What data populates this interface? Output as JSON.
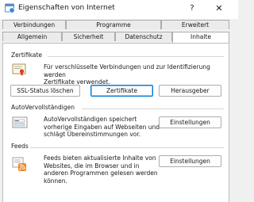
{
  "window": {
    "title": "Eigenschaften von Internet",
    "help_glyph": "?",
    "close_glyph": "✕"
  },
  "tabs": {
    "row1": [
      {
        "label": "Verbindungen"
      },
      {
        "label": "Programme"
      },
      {
        "label": "Erweitert"
      }
    ],
    "row2": [
      {
        "label": "Allgemein"
      },
      {
        "label": "Sicherheit"
      },
      {
        "label": "Datenschutz"
      },
      {
        "label": "Inhalte",
        "active": true
      }
    ]
  },
  "certificates": {
    "heading": "Zertifikate",
    "description": [
      "Für verschlüsselte Verbindungen und zur Identifizierung werden",
      "Zertifikate verwendet."
    ],
    "ssl_button": "SSL-Status löschen",
    "certs_button": "Zertifikate",
    "publisher_button": "Herausgeber"
  },
  "autocomplete": {
    "heading": "AutoVervollständigen",
    "description": [
      "AutoVervollständigen speichert",
      "vorherige Eingaben auf Webseiten und",
      "schlägt Übereinstimmungen vor."
    ],
    "settings_button": "Einstellungen"
  },
  "feeds": {
    "heading": "Feeds",
    "description": [
      "Feeds bieten aktualisierte Inhalte von",
      "Websites, die im Browser und in",
      "anderen Programmen gelesen werden",
      "können."
    ],
    "settings_button": "Einstellungen"
  },
  "colors": {
    "accent": "#0078d4",
    "feed_orange": "#f08a24"
  }
}
